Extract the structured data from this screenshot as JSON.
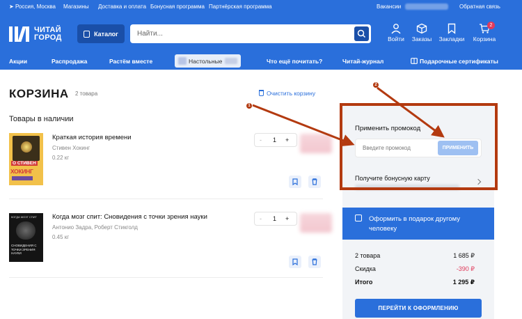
{
  "topbar": {
    "location": "Россия, Москва",
    "links": [
      "Магазины",
      "Доставка и оплата",
      "Бонусная программа",
      "Партнёрская программа"
    ],
    "vacancies": "Вакансии",
    "feedback": "Обратная связь"
  },
  "header": {
    "logo_line1": "ЧИТАЙ",
    "logo_line2": "ГОРОД",
    "catalog_label": "Каталог",
    "search_placeholder": "Найти...",
    "icons": [
      {
        "icon": "user-icon",
        "label": "Войти"
      },
      {
        "icon": "box-icon",
        "label": "Заказы"
      },
      {
        "icon": "bookmark-icon",
        "label": "Закладки"
      },
      {
        "icon": "cart-icon",
        "label": "Корзина",
        "badge": "2"
      }
    ]
  },
  "nav": {
    "items": [
      "Акции",
      "Распродажа",
      "Растём вместе",
      "Настольные",
      "Что ещё почитать?",
      "Читай-журнал",
      "Подарочные сертификаты"
    ]
  },
  "cart": {
    "title": "КОРЗИНА",
    "count": "2 товара",
    "clear_label": "Очистить корзину",
    "section_title": "Товары в наличии",
    "items": [
      {
        "title": "Краткая история времени",
        "author": "Стивен Хокинг",
        "weight": "0.22 кг",
        "qty": "1",
        "cover_top": "О СТИВЕН",
        "cover_main": "ХОКИНГ"
      },
      {
        "title": "Когда мозг спит: Сновидения с точки зрения науки",
        "author": "Антонио Задра, Роберт Стикголд",
        "weight": "0.45 кг",
        "qty": "1",
        "cover_top": "КОГДА МОЗГ СПИТ",
        "cover_main": "СНОВИДЕНИЯ С ТОЧКИ ЗРЕНИЯ НАУКИ"
      }
    ],
    "stepper_minus": "-",
    "stepper_plus": "+"
  },
  "sidebar": {
    "promo_title": "Применить промокод",
    "promo_placeholder": "Введите промокод",
    "apply_label": "ПРИМЕНИТЬ",
    "bonus_title": "Получите бонусную карту",
    "gift_label": "Оформить в подарок другому человеку",
    "summary": [
      {
        "label": "2 товара",
        "value": "1 685 ₽"
      },
      {
        "label": "Скидка",
        "value": "-390 ₽"
      },
      {
        "label": "Итого",
        "value": "1 295 ₽"
      }
    ],
    "checkout_label": "ПЕРЕЙТИ К ОФОРМЛЕНИЮ"
  },
  "annotations": {
    "marker1": "1",
    "marker2": "2"
  },
  "colors": {
    "brand_blue": "#2a6fdb",
    "annotation": "#b33a10",
    "discount": "#e03a5b"
  }
}
